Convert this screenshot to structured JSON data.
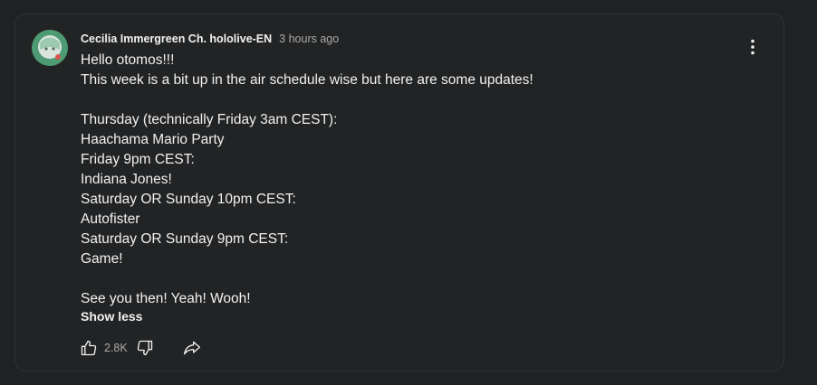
{
  "comment": {
    "author": "Cecilia Immergreen Ch. hololive-EN",
    "timestamp": "3 hours ago",
    "lines": [
      "Hello otomos!!!",
      "This week is a bit up in the air schedule wise but here are some updates!",
      "",
      "Thursday (technically Friday 3am CEST):",
      "Haachama Mario Party",
      "Friday 9pm CEST:",
      "Indiana Jones!",
      "Saturday OR Sunday 10pm CEST:",
      "Autofister",
      "Saturday OR Sunday 9pm CEST:",
      "Game!",
      "",
      "See you then! Yeah! Wooh!"
    ],
    "show_less_label": "Show less",
    "like_count": "2.8K"
  },
  "icons": {
    "menu": "more-vert-icon",
    "like": "thumbs-up-icon",
    "dislike": "thumbs-down-icon",
    "share": "share-icon"
  },
  "colors": {
    "background": "#202124",
    "text": "#f1f1f1",
    "muted": "#aaaaaa"
  }
}
